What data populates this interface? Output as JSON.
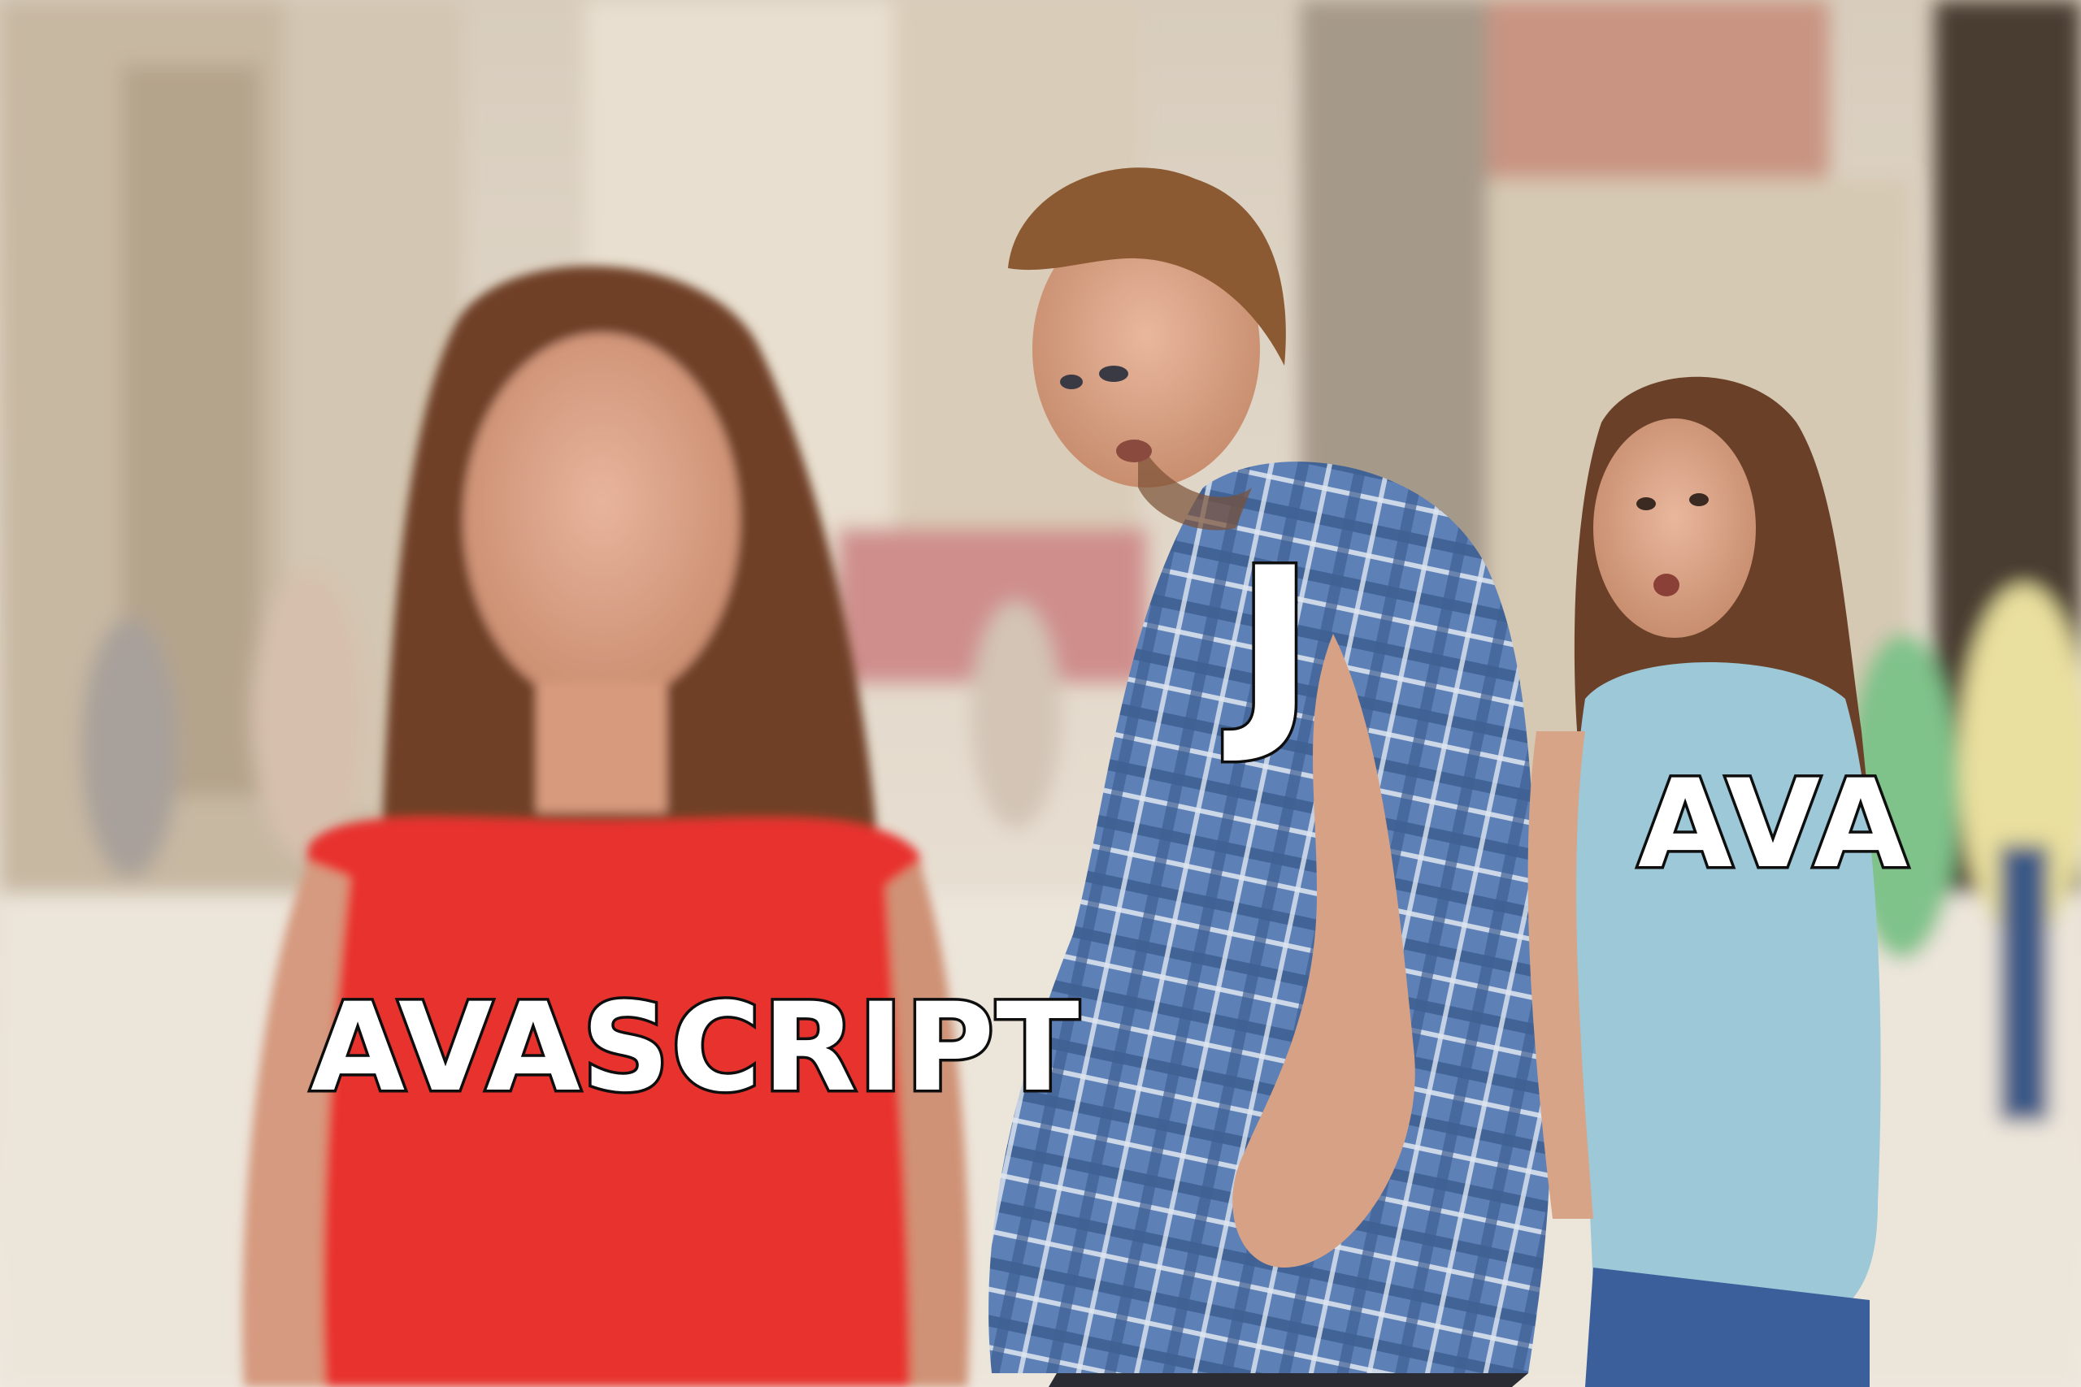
{
  "captions": {
    "left": "AVASCRIPT",
    "middle": "J",
    "right": "AVA"
  },
  "colors": {
    "red_dress": "#e8302d",
    "plaid_shirt": "#5b7fb5",
    "blue_top": "#9cc8d8",
    "jeans": "#3b5f9a",
    "street": "#ede6dc"
  }
}
